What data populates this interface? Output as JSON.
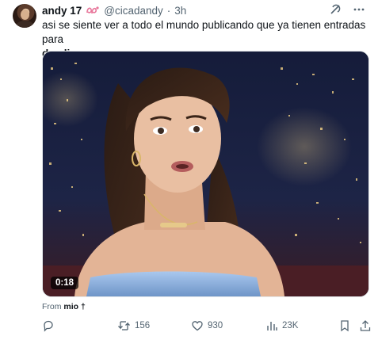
{
  "tweet": {
    "author_name": "andy 17",
    "handle": "@cicadandy",
    "separator": "·",
    "time": "3h",
    "text_line": "asi se siente ver a todo el mundo publicando que ya tienen entradas para",
    "text_bold": "dua lipa",
    "media": {
      "duration": "0:18"
    },
    "from_label": "From",
    "from_source": "mio",
    "from_source_mark": "†",
    "actions": {
      "reposts": "156",
      "likes": "930",
      "views": "23K"
    },
    "icons": [
      "avatar",
      "decorative-emoji-icon",
      "grok-icon",
      "more-icon",
      "reply-icon",
      "repost-icon",
      "like-icon",
      "views-icon",
      "bookmark-icon",
      "share-icon"
    ],
    "accent_color": "#536471"
  }
}
